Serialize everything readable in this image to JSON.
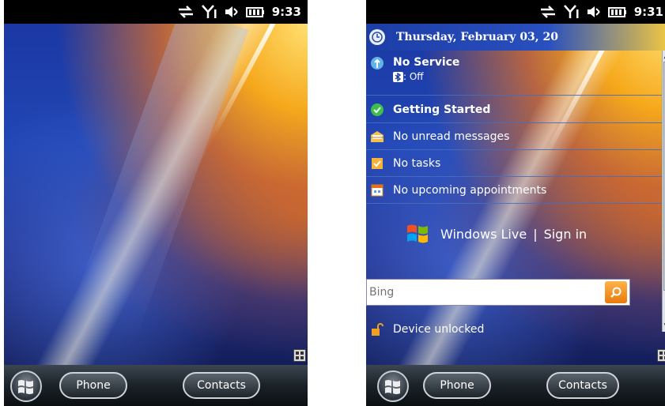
{
  "left": {
    "status": {
      "time": "9:33"
    },
    "softkeys": {
      "left": "Phone",
      "right": "Contacts"
    }
  },
  "right": {
    "status": {
      "time": "9:31"
    },
    "date": "Thursday, February 03, 20",
    "rows": [
      {
        "icon": "signal-tower-icon",
        "label": "No Service",
        "sub": ": Off",
        "sub_icon": "bluetooth-icon"
      },
      {
        "icon": "getting-started-icon",
        "label": "Getting Started"
      },
      {
        "icon": "envelope-icon",
        "label": "No unread messages"
      },
      {
        "icon": "tasks-icon",
        "label": "No tasks"
      },
      {
        "icon": "calendar-icon",
        "label": "No upcoming appointments"
      }
    ],
    "windows_live": {
      "brand": "Windows Live",
      "separator": "|",
      "action": "Sign in"
    },
    "search": {
      "placeholder": "Bing"
    },
    "lock_status": "Device unlocked",
    "softkeys": {
      "left": "Phone",
      "right": "Contacts"
    }
  },
  "colors": {
    "accent_orange": "#f08a1c",
    "row_divider": "#466ebe",
    "wallpaper_blue": "#1b38a4"
  }
}
